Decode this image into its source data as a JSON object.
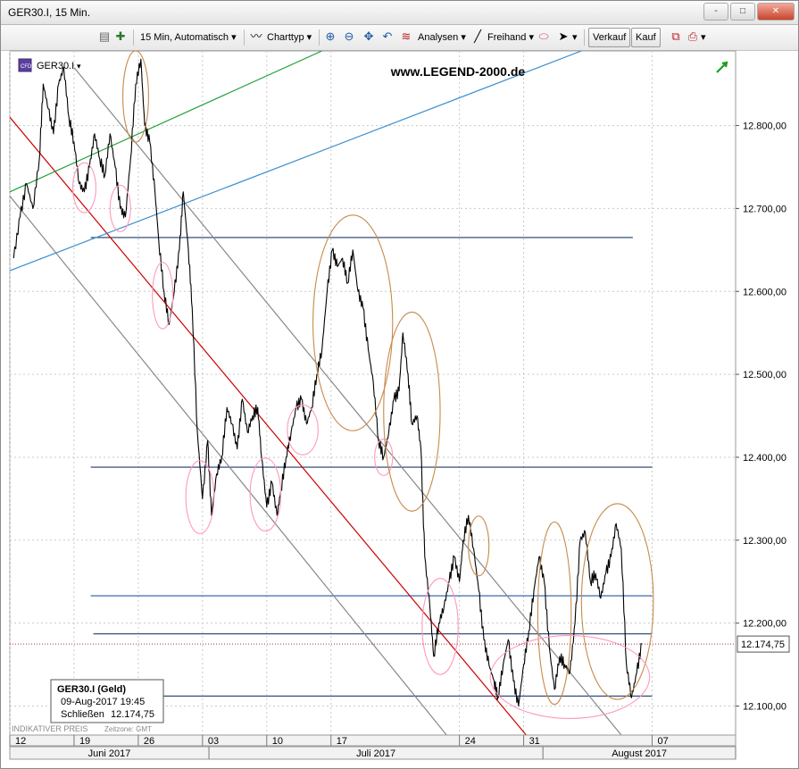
{
  "window": {
    "title": "GER30.I, 15 Min.",
    "buttons": [
      "-",
      "□",
      "✕"
    ]
  },
  "toolbar": {
    "instrument_placeholder": "Instrument",
    "timeframe": "15 Min,  Automatisch",
    "charttyp": "Charttyp",
    "analysen": "Analysen",
    "freihand": "Freihand",
    "verkauf": "Verkauf",
    "kauf": "Kauf"
  },
  "chart_data": {
    "type": "line",
    "symbol_label": "GER30.I",
    "watermark": "www.LEGEND-2000.de",
    "price_label": "12.174,75",
    "last_price": 12174.75,
    "ylim": [
      12065,
      12890
    ],
    "y_ticks": [
      {
        "value": 12100,
        "label": "12.100,00"
      },
      {
        "value": 12200,
        "label": "12.200,00"
      },
      {
        "value": 12300,
        "label": "12.300,00"
      },
      {
        "value": 12400,
        "label": "12.400,00"
      },
      {
        "value": 12500,
        "label": "12.500,00"
      },
      {
        "value": 12600,
        "label": "12.600,00"
      },
      {
        "value": 12700,
        "label": "12.700,00"
      },
      {
        "value": 12800,
        "label": "12.800,00"
      }
    ],
    "xlim": [
      0,
      56.5
    ],
    "x_ticks": [
      {
        "x": 0,
        "label": "12"
      },
      {
        "x": 5,
        "label": "19"
      },
      {
        "x": 10,
        "label": "26"
      },
      {
        "x": 15,
        "label": "03"
      },
      {
        "x": 20,
        "label": "10"
      },
      {
        "x": 25,
        "label": "17"
      },
      {
        "x": 35,
        "label": "24"
      },
      {
        "x": 40,
        "label": "31"
      },
      {
        "x": 50,
        "label": "07"
      }
    ],
    "months": [
      {
        "from": 0,
        "to": 15.5,
        "label": "Juni 2017"
      },
      {
        "from": 15.5,
        "to": 41.5,
        "label": "Juli 2017"
      },
      {
        "from": 41.5,
        "to": 56.5,
        "label": "August 2017"
      }
    ],
    "series": [
      {
        "color": "#000000",
        "points": [
          [
            0.3,
            12640
          ],
          [
            0.8,
            12690
          ],
          [
            1.3,
            12730
          ],
          [
            1.8,
            12700
          ],
          [
            2.3,
            12760
          ],
          [
            2.6,
            12850
          ],
          [
            3.0,
            12820
          ],
          [
            3.4,
            12790
          ],
          [
            3.8,
            12850
          ],
          [
            4.2,
            12870
          ],
          [
            4.6,
            12810
          ],
          [
            5.0,
            12780
          ],
          [
            5.4,
            12730
          ],
          [
            5.8,
            12720
          ],
          [
            6.2,
            12750
          ],
          [
            6.6,
            12790
          ],
          [
            7.0,
            12760
          ],
          [
            7.4,
            12740
          ],
          [
            7.8,
            12790
          ],
          [
            8.2,
            12750
          ],
          [
            8.6,
            12700
          ],
          [
            9.0,
            12690
          ],
          [
            9.4,
            12760
          ],
          [
            9.8,
            12850
          ],
          [
            10.2,
            12880
          ],
          [
            10.5,
            12800
          ],
          [
            10.9,
            12780
          ],
          [
            11.3,
            12720
          ],
          [
            11.6,
            12660
          ],
          [
            12.0,
            12600
          ],
          [
            12.4,
            12560
          ],
          [
            12.8,
            12600
          ],
          [
            13.2,
            12650
          ],
          [
            13.5,
            12720
          ],
          [
            13.9,
            12650
          ],
          [
            14.2,
            12580
          ],
          [
            14.6,
            12430
          ],
          [
            15.0,
            12350
          ],
          [
            15.4,
            12420
          ],
          [
            15.7,
            12330
          ],
          [
            16.1,
            12380
          ],
          [
            16.5,
            12400
          ],
          [
            16.9,
            12460
          ],
          [
            17.3,
            12440
          ],
          [
            17.7,
            12410
          ],
          [
            18.1,
            12470
          ],
          [
            18.5,
            12430
          ],
          [
            18.9,
            12450
          ],
          [
            19.3,
            12460
          ],
          [
            19.6,
            12400
          ],
          [
            20.0,
            12340
          ],
          [
            20.4,
            12370
          ],
          [
            20.8,
            12330
          ],
          [
            21.1,
            12360
          ],
          [
            21.5,
            12400
          ],
          [
            21.9,
            12430
          ],
          [
            22.3,
            12460
          ],
          [
            22.7,
            12470
          ],
          [
            23.1,
            12440
          ],
          [
            23.5,
            12460
          ],
          [
            23.9,
            12500
          ],
          [
            24.3,
            12530
          ],
          [
            24.7,
            12600
          ],
          [
            25.1,
            12650
          ],
          [
            25.5,
            12630
          ],
          [
            25.9,
            12640
          ],
          [
            26.3,
            12610
          ],
          [
            26.7,
            12650
          ],
          [
            27.1,
            12600
          ],
          [
            27.5,
            12580
          ],
          [
            27.9,
            12530
          ],
          [
            28.3,
            12490
          ],
          [
            28.7,
            12420
          ],
          [
            29.1,
            12400
          ],
          [
            29.5,
            12430
          ],
          [
            29.9,
            12470
          ],
          [
            30.3,
            12480
          ],
          [
            30.6,
            12550
          ],
          [
            31.0,
            12500
          ],
          [
            31.3,
            12440
          ],
          [
            31.7,
            12450
          ],
          [
            32.0,
            12410
          ],
          [
            32.3,
            12280
          ],
          [
            32.7,
            12220
          ],
          [
            33.0,
            12160
          ],
          [
            33.4,
            12200
          ],
          [
            33.8,
            12220
          ],
          [
            34.2,
            12250
          ],
          [
            34.6,
            12280
          ],
          [
            35.0,
            12250
          ],
          [
            35.3,
            12300
          ],
          [
            35.7,
            12330
          ],
          [
            36.1,
            12290
          ],
          [
            36.5,
            12240
          ],
          [
            36.9,
            12180
          ],
          [
            37.3,
            12150
          ],
          [
            37.7,
            12130
          ],
          [
            38.0,
            12110
          ],
          [
            38.4,
            12150
          ],
          [
            38.8,
            12180
          ],
          [
            39.2,
            12130
          ],
          [
            39.6,
            12100
          ],
          [
            40.0,
            12150
          ],
          [
            40.4,
            12190
          ],
          [
            40.8,
            12240
          ],
          [
            41.2,
            12280
          ],
          [
            41.6,
            12250
          ],
          [
            42.0,
            12170
          ],
          [
            42.4,
            12120
          ],
          [
            42.8,
            12160
          ],
          [
            43.2,
            12150
          ],
          [
            43.6,
            12140
          ],
          [
            44.0,
            12200
          ],
          [
            44.4,
            12300
          ],
          [
            44.8,
            12310
          ],
          [
            45.2,
            12250
          ],
          [
            45.6,
            12260
          ],
          [
            46.0,
            12230
          ],
          [
            46.4,
            12260
          ],
          [
            46.8,
            12280
          ],
          [
            47.2,
            12320
          ],
          [
            47.6,
            12290
          ],
          [
            48.0,
            12150
          ],
          [
            48.4,
            12110
          ],
          [
            48.8,
            12140
          ],
          [
            49.2,
            12175
          ]
        ]
      }
    ],
    "annotations": {
      "trendlines": [
        {
          "color": "#cc0000",
          "from": [
            0,
            12810
          ],
          "to": [
            40.2,
            12065
          ]
        },
        {
          "color": "#888888",
          "from": [
            0,
            12715
          ],
          "to": [
            34.0,
            12065
          ]
        },
        {
          "color": "#888888",
          "from": [
            5.0,
            12870
          ],
          "to": [
            47.6,
            12065
          ]
        },
        {
          "color": "#22a03a",
          "from": [
            0,
            12720
          ],
          "to": [
            24.3,
            12890
          ]
        },
        {
          "color": "#3b8fd0",
          "from": [
            0,
            12625
          ],
          "to": [
            44.5,
            12890
          ]
        }
      ],
      "levels": [
        {
          "color": "#1f3b6a",
          "value": 12665,
          "from": 6.3,
          "to": 48.5
        },
        {
          "color": "#1f3b6a",
          "value": 12388,
          "from": 6.3,
          "to": 50.0
        },
        {
          "color": "#1f5aa0",
          "value": 12233,
          "from": 6.3,
          "to": 50.0
        },
        {
          "color": "#1f3b6a",
          "value": 12187,
          "from": 6.5,
          "to": 50.0
        },
        {
          "color": "#1f3b6a",
          "value": 12112,
          "from": 3.5,
          "to": 50.0
        }
      ],
      "ellipses": [
        {
          "color": "#c88a4a",
          "cx": 9.8,
          "cy": 12835,
          "rx": 1.0,
          "ry": 55
        },
        {
          "color": "#ff99bb",
          "cx": 5.8,
          "cy": 12725,
          "rx": 0.9,
          "ry": 30
        },
        {
          "color": "#ff99bb",
          "cx": 8.6,
          "cy": 12700,
          "rx": 0.8,
          "ry": 28
        },
        {
          "color": "#ff99bb",
          "cx": 11.9,
          "cy": 12595,
          "rx": 0.8,
          "ry": 40
        },
        {
          "color": "#ff99bb",
          "cx": 14.8,
          "cy": 12352,
          "rx": 1.1,
          "ry": 44
        },
        {
          "color": "#ff99bb",
          "cx": 19.9,
          "cy": 12355,
          "rx": 1.2,
          "ry": 44
        },
        {
          "color": "#ff99bb",
          "cx": 22.8,
          "cy": 12433,
          "rx": 1.2,
          "ry": 30
        },
        {
          "color": "#ff99bb",
          "cx": 29.1,
          "cy": 12400,
          "rx": 0.7,
          "ry": 22
        },
        {
          "color": "#c88a4a",
          "cx": 26.7,
          "cy": 12562,
          "rx": 3.1,
          "ry": 130
        },
        {
          "color": "#c88a4a",
          "cx": 31.3,
          "cy": 12455,
          "rx": 2.2,
          "ry": 120
        },
        {
          "color": "#ff99bb",
          "cx": 33.5,
          "cy": 12196,
          "rx": 1.4,
          "ry": 58
        },
        {
          "color": "#c88a4a",
          "cx": 36.5,
          "cy": 12293,
          "rx": 0.8,
          "ry": 36
        },
        {
          "color": "#c88a4a",
          "cx": 42.4,
          "cy": 12212,
          "rx": 1.3,
          "ry": 110
        },
        {
          "color": "#c88a4a",
          "cx": 47.3,
          "cy": 12226,
          "rx": 2.8,
          "ry": 118
        },
        {
          "color": "#ff99bb",
          "cx": 43.6,
          "cy": 12135,
          "rx": 6.2,
          "ry": 50
        }
      ]
    },
    "legend_box": {
      "title": "GER30.I (Geld)",
      "datetime": "09-Aug-2017 19:45",
      "close_label": "Schließen",
      "close_value": "12.174,75"
    },
    "footer_left": "INDIKATIVER PREIS",
    "footer_zone": "Zeitzone: GMT"
  }
}
